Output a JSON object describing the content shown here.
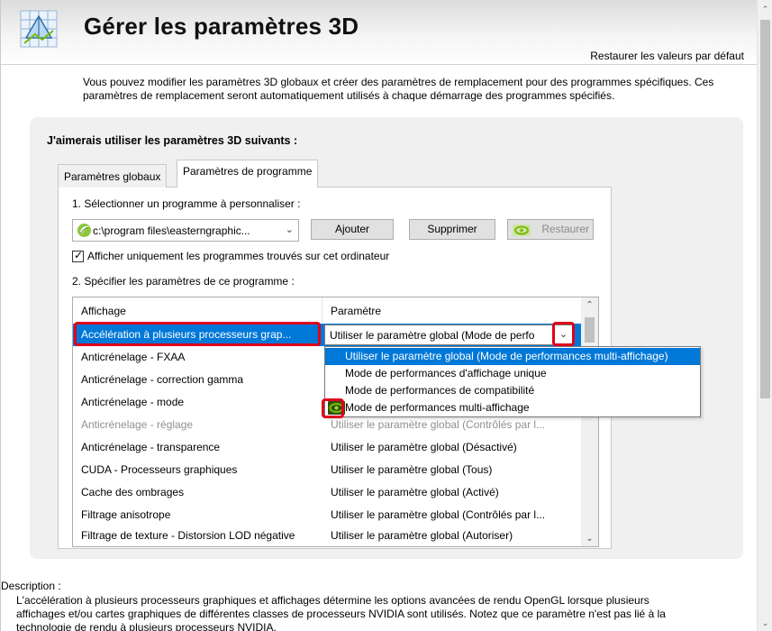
{
  "header": {
    "title": "Gérer les paramètres 3D",
    "restore_link": "Restaurer les valeurs par défaut",
    "icon": "nvidia-3d-settings-icon"
  },
  "intro": "Vous pouvez modifier les paramètres 3D globaux et créer des paramètres de remplacement pour des programmes spécifiques. Ces paramètres de remplacement seront automatiquement utilisés à chaque démarrage des programmes spécifiés.",
  "panel": {
    "title": "J'aimerais utiliser les paramètres 3D suivants :",
    "tabs": [
      {
        "label": "Paramètres globaux",
        "selected": false
      },
      {
        "label": "Paramètres de programme",
        "selected": true
      }
    ]
  },
  "program": {
    "step1_label": "1. Sélectionner un programme à personnaliser :",
    "selected_program": "c:\\program files\\easterngraphic...",
    "add_button": "Ajouter",
    "remove_button": "Supprimer",
    "restore_button": "Restaurer",
    "checkbox_label": "Afficher uniquement les programmes trouvés sur cet ordinateur",
    "checkbox_checked": true,
    "step2_label": "2. Spécifier les paramètres de ce programme :"
  },
  "settings_table": {
    "columns": [
      "Affichage",
      "Paramètre"
    ],
    "rows": [
      {
        "feature": "Accélération à plusieurs processeurs grap...",
        "value": "Utiliser le paramètre global (Mode de perfo",
        "selected": true
      },
      {
        "feature": "Anticrénelage - FXAA",
        "value": ""
      },
      {
        "feature": "Anticrénelage - correction gamma",
        "value": ""
      },
      {
        "feature": "Anticrénelage - mode",
        "value": ""
      },
      {
        "feature": "Anticrénelage - réglage",
        "value": "Utiliser le paramètre global (Contrôlés par l...",
        "disabled": true
      },
      {
        "feature": "Anticrénelage - transparence",
        "value": "Utiliser le paramètre global (Désactivé)"
      },
      {
        "feature": "CUDA - Processeurs graphiques",
        "value": "Utiliser le paramètre global (Tous)"
      },
      {
        "feature": "Cache des ombrages",
        "value": "Utiliser le paramètre global (Activé)"
      },
      {
        "feature": "Filtrage anisotrope",
        "value": "Utiliser le paramètre global (Contrôlés par l..."
      },
      {
        "feature": "Filtrage de texture - Distorsion LOD négative",
        "value": "Utiliser le paramètre global (Autoriser)"
      }
    ]
  },
  "dropdown": {
    "options": [
      {
        "label": "Utiliser le paramètre global (Mode de performances multi-affichage)",
        "highlighted": true
      },
      {
        "label": "Mode de performances d'affichage unique"
      },
      {
        "label": "Mode de performances de compatibilité"
      },
      {
        "label": "Mode de performances multi-affichage",
        "nvidia_recommended": true
      }
    ]
  },
  "description": {
    "label": "Description :",
    "text": "L'accélération à plusieurs processeurs graphiques et affichages détermine les options avancées de rendu OpenGL lorsque plusieurs affichages et/ou cartes graphiques de différentes classes de processeurs NVIDIA sont utilisés. Notez que ce paramètre n'est pas lié à la technologie de rendu à plusieurs processeurs NVIDIA."
  },
  "colors": {
    "selection": "#0078d7",
    "highlight_box": "#e0001b",
    "nvidia_green": "#76b900",
    "panel_bg": "#f0f0f0"
  }
}
